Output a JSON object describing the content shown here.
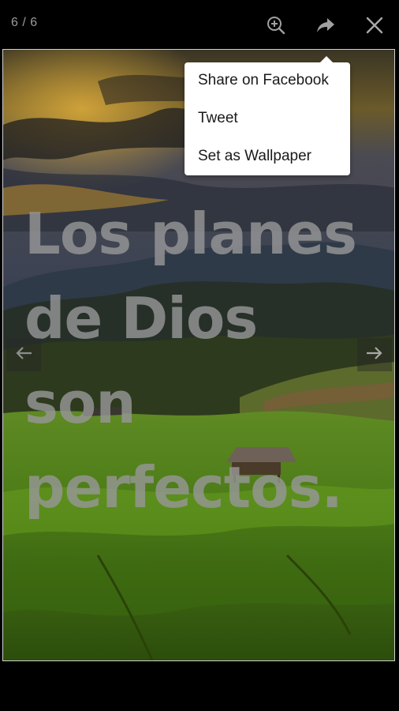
{
  "toolbar": {
    "counter": "6 / 6",
    "icons": {
      "zoom": "zoom-in-icon",
      "share": "share-arrow-icon",
      "close": "close-icon"
    }
  },
  "menu": {
    "items": [
      {
        "label": "Share on Facebook"
      },
      {
        "label": "Tweet"
      },
      {
        "label": "Set as Wallpaper"
      }
    ]
  },
  "image": {
    "quote_lines": [
      "Los planes",
      "de Dios",
      "son",
      "perfectos."
    ]
  },
  "nav": {
    "prev_icon": "arrow-left-icon",
    "next_icon": "arrow-right-icon"
  },
  "colors": {
    "background": "#000000",
    "menu_bg": "#ffffff",
    "quote_text": "#969696",
    "icon": "#a0a0a0"
  }
}
